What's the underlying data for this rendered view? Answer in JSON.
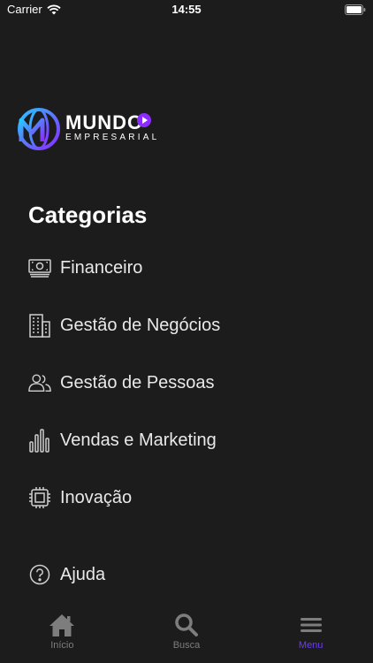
{
  "status": {
    "carrier": "Carrier",
    "time": "14:55"
  },
  "logo": {
    "title": "MUNDO",
    "subtitle": "EMPRESARIAL"
  },
  "heading": "Categorias",
  "categories": [
    {
      "label": "Financeiro",
      "icon": "money-icon"
    },
    {
      "label": "Gestão de Negócios",
      "icon": "building-icon"
    },
    {
      "label": "Gestão de Pessoas",
      "icon": "people-icon"
    },
    {
      "label": "Vendas e Marketing",
      "icon": "bar-chart-icon"
    },
    {
      "label": "Inovação",
      "icon": "chip-icon"
    }
  ],
  "help": {
    "label": "Ajuda",
    "icon": "question-icon"
  },
  "tabs": [
    {
      "label": "Início",
      "icon": "home-icon"
    },
    {
      "label": "Busca",
      "icon": "search-icon"
    },
    {
      "label": "Menu",
      "icon": "menu-icon",
      "active": true
    }
  ],
  "colors": {
    "background": "#1c1c1c",
    "accent": "#6b3df0",
    "logo_gradient": [
      "#2bc3ff",
      "#8b2cff"
    ]
  }
}
